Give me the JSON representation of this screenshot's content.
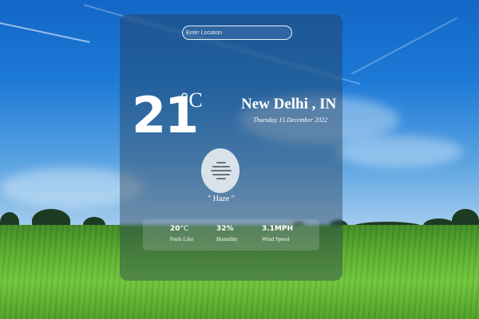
{
  "search": {
    "placeholder": "Enter Location"
  },
  "weather": {
    "temperature": "21",
    "temperature_unit": "°C",
    "city": "New Delhi , IN",
    "date": "Thursday 15 December 2022",
    "condition": "\" Haze \"",
    "icon": "haze-icon"
  },
  "stats": {
    "feels_like": {
      "value": "20",
      "unit": "°C",
      "label": "Feels Like"
    },
    "humidity": {
      "value": "32",
      "unit": "%",
      "label": "Humidity"
    },
    "wind_speed": {
      "value": "3.1",
      "unit": "MPH",
      "label": "Wind Speed"
    }
  },
  "colors": {
    "card_overlay": "#283c50",
    "text": "#ffffff",
    "icon_circle": "#d9e2ea",
    "icon_lines": "#6b7178"
  }
}
